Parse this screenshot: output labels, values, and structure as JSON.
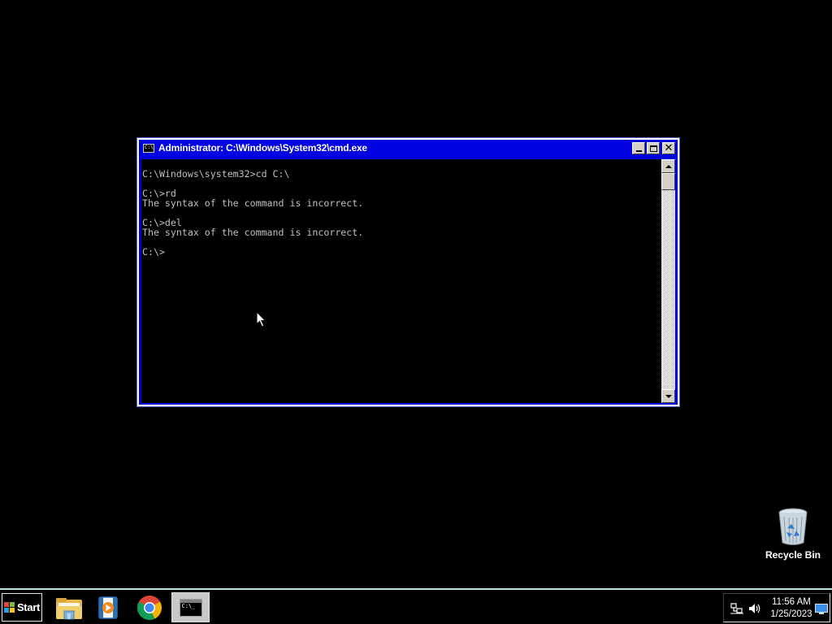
{
  "window": {
    "title": "Administrator: C:\\Windows\\System32\\cmd.exe",
    "icon_text": "C:\\",
    "console_output": "C:\\Windows\\system32>cd C:\\\n\nC:\\>rd\nThe syntax of the command is incorrect.\n\nC:\\>del\nThe syntax of the command is incorrect.\n\nC:\\>",
    "controls": [
      "minimize-icon",
      "maximize-icon",
      "close-icon"
    ]
  },
  "desktop": {
    "recycle_bin_label": "Recycle Bin"
  },
  "taskbar": {
    "start_label": "Start",
    "apps": [
      "windows-explorer-icon",
      "media-player-icon",
      "chrome-icon",
      "command-prompt-icon"
    ],
    "active_app": "command-prompt",
    "cmd_icon_text": "C:\\_",
    "tray": {
      "time": "11:56 AM",
      "date": "1/25/2023",
      "icons": [
        "network-icon",
        "volume-icon",
        "show-desktop-icon"
      ]
    }
  },
  "colors": {
    "titlebar": "#0000e0",
    "console_bg": "#000000",
    "console_fg": "#c0c0c0",
    "desktop_bg": "#000000",
    "taskbar_border": "#bfe4e4"
  }
}
